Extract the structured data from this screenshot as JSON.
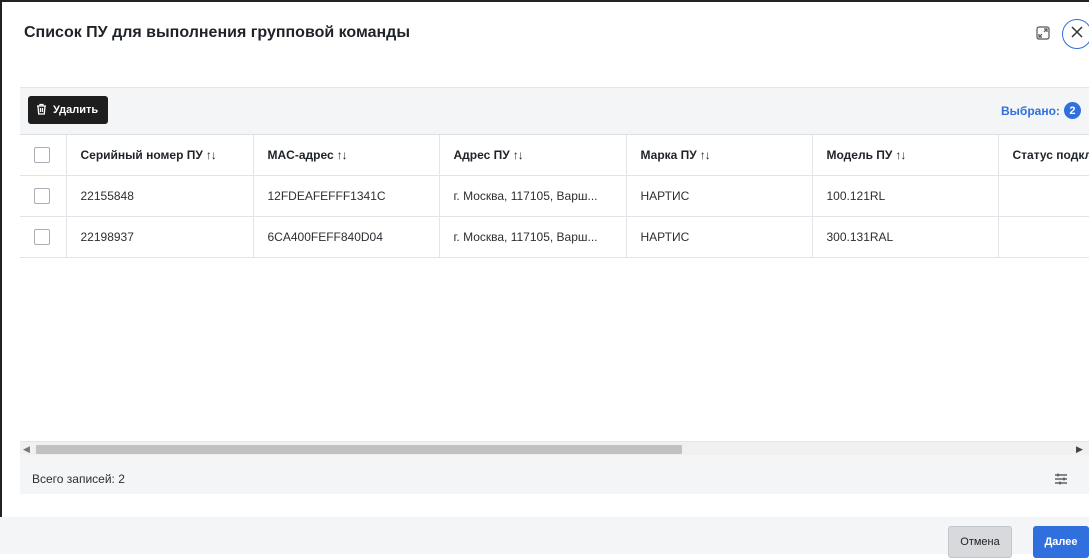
{
  "dialog": {
    "title": "Список ПУ для выполнения групповой команды"
  },
  "toolbar": {
    "delete_label": "Удалить",
    "selected_label": "Выбрано:",
    "selected_count": "2"
  },
  "table": {
    "columns": [
      {
        "label": "Серийный номер ПУ",
        "sort": "↑↓"
      },
      {
        "label": "MAC-адрес",
        "sort": "↑↓"
      },
      {
        "label": "Адрес ПУ",
        "sort": "↑↓"
      },
      {
        "label": "Марка ПУ",
        "sort": "↑↓"
      },
      {
        "label": "Модель ПУ",
        "sort": "↑↓"
      },
      {
        "label": "Статус подкл",
        "sort": ""
      }
    ],
    "rows": [
      {
        "serial": "22155848",
        "mac": "12FDEAFEFFF1341C",
        "address": "г. Москва, 117105, Варш...",
        "brand": "НАРТИС",
        "model": "100.121RL",
        "status": ""
      },
      {
        "serial": "22198937",
        "mac": "6CA400FEFF840D04",
        "address": "г. Москва, 117105, Варш...",
        "brand": "НАРТИС",
        "model": "300.131RAL",
        "status": ""
      }
    ]
  },
  "footer": {
    "total_label": "Всего записей: 2"
  },
  "actions": {
    "cancel_label": "Отмена",
    "next_label": "Далее"
  },
  "colors": {
    "accent": "#2f6fde",
    "dark_button": "#1e1e1e"
  }
}
